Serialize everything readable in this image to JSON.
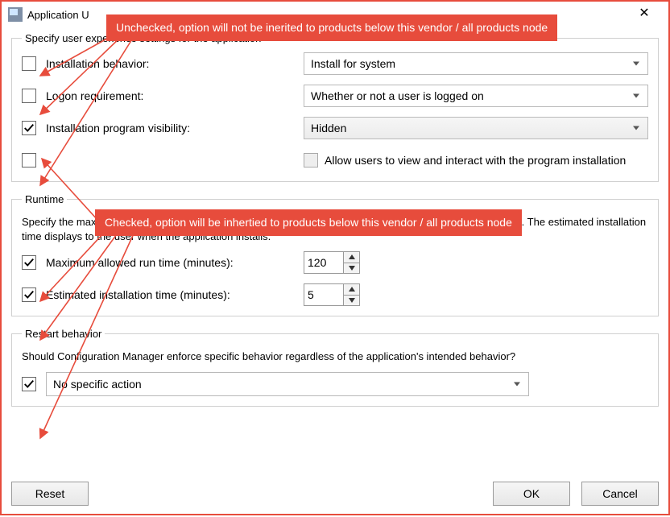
{
  "window": {
    "title": "Application U",
    "close_glyph": "✕"
  },
  "callouts": {
    "unchecked": "Unchecked, option will not be inerited to products below this vendor / all products node",
    "checked": "Checked, option will be inhertied to products below this vendor / all products node"
  },
  "ux_group": {
    "legend": "Specify user experience settings for the application",
    "install_behavior": {
      "checked": false,
      "label": "Installation behavior:",
      "value": "Install for system"
    },
    "logon_requirement": {
      "checked": false,
      "label": "Logon requirement:",
      "value": "Whether or not a user is logged on"
    },
    "install_visibility": {
      "checked": true,
      "label": "Installation program visibility:",
      "value": "Hidden"
    },
    "allow_interaction": {
      "row_checked": false,
      "inner_checked": false,
      "label": "Allow users to view and interact with the program installation"
    }
  },
  "runtime_group": {
    "legend": "Runtime",
    "description": "Specify the maximum run time and estimated installation time of the deployment program for this application. The estimated installation time displays to the user when the application installs.",
    "max_runtime": {
      "checked": true,
      "label": "Maximum allowed run time (minutes):",
      "value": "120"
    },
    "est_install": {
      "checked": true,
      "label": "Estimated installation time (minutes):",
      "value": "5"
    }
  },
  "restart_group": {
    "legend": "Restart behavior",
    "question": "Should Configuration Manager enforce specific behavior regardless of the application's intended behavior?",
    "checked": true,
    "value": "No specific action"
  },
  "buttons": {
    "reset": "Reset",
    "ok": "OK",
    "cancel": "Cancel"
  },
  "colors": {
    "accent_red": "#e74c3c"
  }
}
